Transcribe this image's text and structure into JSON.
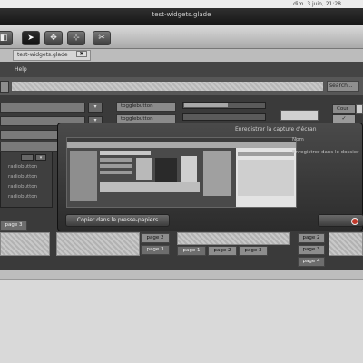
{
  "topbar": {
    "clock": "dim.  3 juin, 21:28"
  },
  "window": {
    "title": "test-widgets.glade"
  },
  "toolbar": {
    "buttons": [
      "◧",
      "➤",
      "✥",
      "⊹",
      "✂"
    ]
  },
  "doc_tab": {
    "label": "test-widgets.glade",
    "close": "✖"
  },
  "menubar": {
    "help": "Help"
  },
  "search": {
    "button": "search..."
  },
  "combo": {
    "arrow": "▾"
  },
  "buttons": {
    "togglebutton": "togglebutton",
    "togglebutton2": "togglebutton"
  },
  "right_panel": {
    "cour": "Cour",
    "check": "✓"
  },
  "list": {
    "arrow": "▾",
    "items": [
      "radiobutton",
      "radiobutton",
      "radiobutton",
      "radiobutton"
    ]
  },
  "tabs": {
    "left_page": "page 3",
    "center_pages": [
      "page 2",
      "page 3"
    ],
    "bottom_pages": [
      "page 1",
      "page 2",
      "page 3"
    ],
    "right_pages": [
      "page 2",
      "page 3",
      "page 4"
    ]
  },
  "dialog": {
    "title": "Enregistrer la capture d'écran",
    "name_label": "Nom",
    "save_in_label": "Enregistrer dans le dossier",
    "copy_button": "Copier dans le presse-papiers"
  }
}
